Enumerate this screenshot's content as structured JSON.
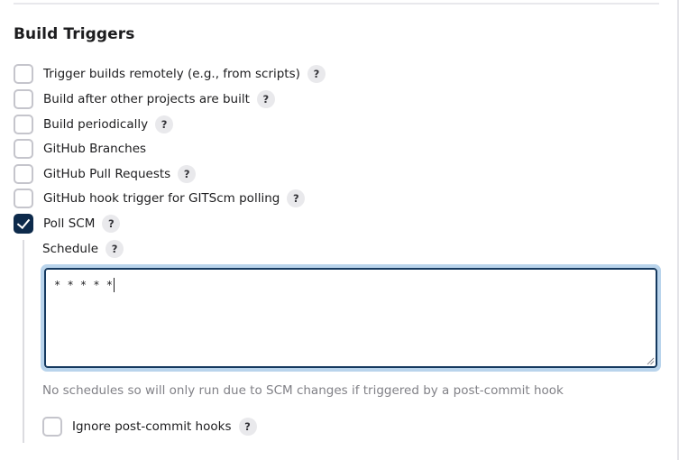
{
  "section": {
    "title": "Build Triggers"
  },
  "triggers": [
    {
      "label": "Trigger builds remotely (e.g., from scripts)",
      "checked": false,
      "help": "?"
    },
    {
      "label": "Build after other projects are built",
      "checked": false,
      "help": "?"
    },
    {
      "label": "Build periodically",
      "checked": false,
      "help": "?"
    },
    {
      "label": "GitHub Branches",
      "checked": false,
      "help": ""
    },
    {
      "label": "GitHub Pull Requests",
      "checked": false,
      "help": "?"
    },
    {
      "label": "GitHub hook trigger for GITScm polling",
      "checked": false,
      "help": "?"
    },
    {
      "label": "Poll SCM",
      "checked": true,
      "help": "?"
    }
  ],
  "poll_scm": {
    "schedule_label": "Schedule",
    "schedule_help": "?",
    "schedule_value": "* * * * *",
    "hint": "No schedules so will only run due to SCM changes if triggered by a post-commit hook",
    "ignore_hooks_label": "Ignore post-commit hooks",
    "ignore_hooks_checked": false,
    "ignore_hooks_help": "?"
  },
  "colors": {
    "checkbox_checked": "#0d2a4b",
    "focus_ring": "#b9d4ec",
    "hint_text": "#818187"
  }
}
